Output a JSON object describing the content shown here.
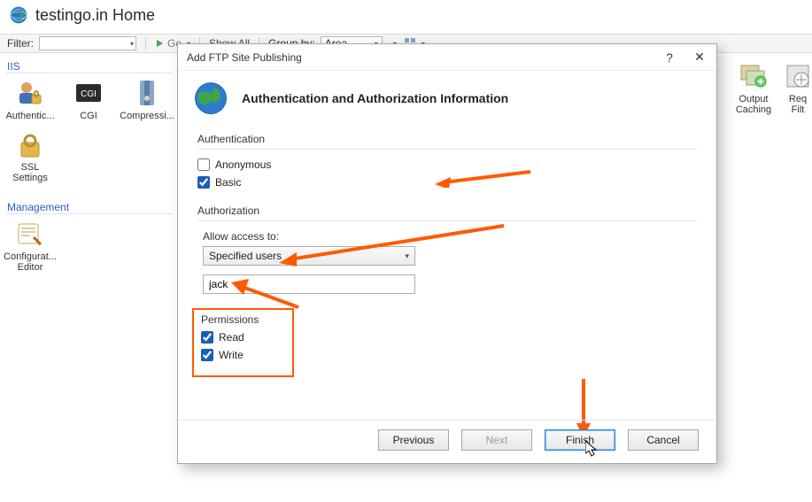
{
  "page": {
    "title": "testingo.in Home"
  },
  "filterbar": {
    "filter_label": "Filter:",
    "go_label": "Go",
    "showall_label": "Show All",
    "groupby_label": "Group by:",
    "group_value": "Area"
  },
  "sidebar": {
    "iis_label": "IIS",
    "mgmt_label": "Management",
    "icons": {
      "auth": "Authentic...",
      "cgi": "CGI",
      "compress": "Compressi...",
      "ssl": "SSL Settings",
      "config": "Configurat...\nEditor"
    }
  },
  "rightstrip": {
    "outcache": "Output\nCaching",
    "reqfilt": "Req\nFilt"
  },
  "dialog": {
    "title": "Add FTP Site Publishing",
    "heading": "Authentication and Authorization Information",
    "auth_section": "Authentication",
    "anon_label": "Anonymous",
    "basic_label": "Basic",
    "authz_section": "Authorization",
    "allow_label": "Allow access to:",
    "access_value": "Specified users",
    "user_value": "jack",
    "perm_section": "Permissions",
    "read_label": "Read",
    "write_label": "Write",
    "buttons": {
      "previous": "Previous",
      "next": "Next",
      "finish": "Finish",
      "cancel": "Cancel"
    }
  }
}
